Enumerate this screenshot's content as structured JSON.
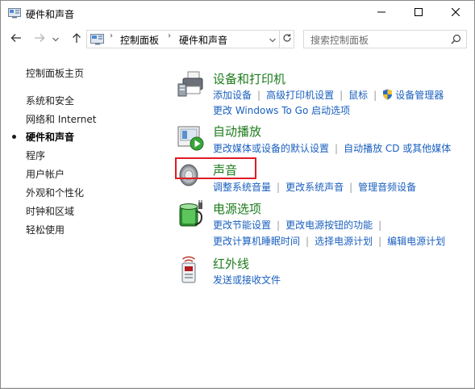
{
  "window": {
    "title": "硬件和声音",
    "icon": "control-panel-icon"
  },
  "titlebar_buttons": [
    "minimize-icon",
    "maximize-icon",
    "close-icon"
  ],
  "address_bar": {
    "crumbs": [
      "控制面板",
      "硬件和声音"
    ],
    "search_placeholder": "搜索控制面板"
  },
  "sidebar": {
    "items": [
      {
        "label": "控制面板主页",
        "active": false
      },
      {
        "label": "系统和安全",
        "active": false
      },
      {
        "label": "网络和 Internet",
        "active": false
      },
      {
        "label": "硬件和声音",
        "active": true
      },
      {
        "label": "程序",
        "active": false
      },
      {
        "label": "用户帐户",
        "active": false
      },
      {
        "label": "外观和个性化",
        "active": false
      },
      {
        "label": "时钟和区域",
        "active": false
      },
      {
        "label": "轻松使用",
        "active": false
      }
    ]
  },
  "categories": [
    {
      "title": "设备和打印机",
      "icon": "printer-icon",
      "rows": [
        [
          "添加设备",
          "高级打印机设置",
          "鼠标",
          "设备管理器"
        ],
        [
          "更改 Windows To Go 启动选项"
        ]
      ]
    },
    {
      "title": "自动播放",
      "icon": "autoplay-icon",
      "rows": [
        [
          "更改媒体或设备的默认设置",
          "自动播放 CD 或其他媒体"
        ]
      ]
    },
    {
      "title": "声音",
      "icon": "speaker-icon",
      "highlighted": true,
      "rows": [
        [
          "调整系统音量",
          "更改系统声音",
          "管理音频设备"
        ]
      ]
    },
    {
      "title": "电源选项",
      "icon": "battery-power-icon",
      "rows": [
        [
          "更改节能设置",
          "更改电源按钮的功能"
        ],
        [
          "更改计算机睡眠时间",
          "选择电源计划",
          "编辑电源计划"
        ]
      ]
    },
    {
      "title": "红外线",
      "icon": "infrared-icon",
      "rows": [
        [
          "发送或接收文件"
        ]
      ]
    }
  ],
  "colors": {
    "category_title": "#1d7c1d",
    "link": "#1a5fbf",
    "highlight_border": "#e01b24"
  }
}
